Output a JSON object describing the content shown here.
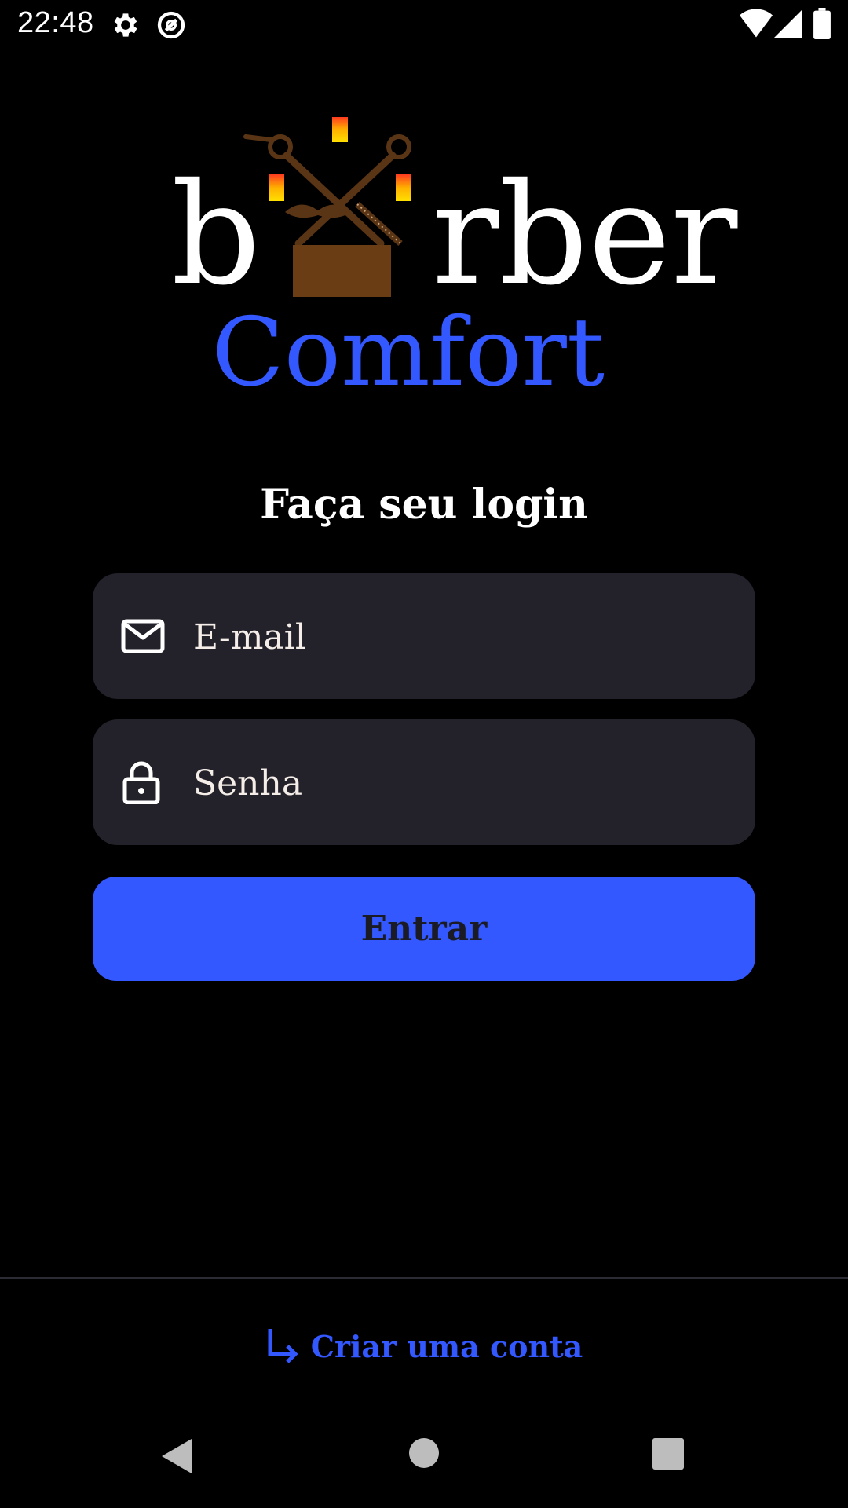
{
  "status_bar": {
    "time": "22:48",
    "icons": [
      "settings-icon",
      "do-not-disturb-icon",
      "wifi-icon",
      "signal-icon",
      "battery-icon"
    ]
  },
  "logo": {
    "word_left": "b",
    "word_right": "rber",
    "subtitle": "Comfort",
    "colors": {
      "text": "#FFFFFF",
      "subtitle": "#3358FF",
      "chair": "#6B3D14",
      "tools": "#5A3515"
    }
  },
  "login": {
    "heading": "Faça seu login",
    "email_placeholder": "E-mail",
    "password_placeholder": "Senha",
    "submit_label": "Entrar"
  },
  "footer": {
    "create_account_label": "Criar uma conta"
  },
  "nav": {
    "buttons": [
      "back-icon",
      "home-icon",
      "recents-icon"
    ]
  },
  "colors": {
    "background": "#000000",
    "field_bg": "#232129",
    "accent": "#3358FF"
  }
}
